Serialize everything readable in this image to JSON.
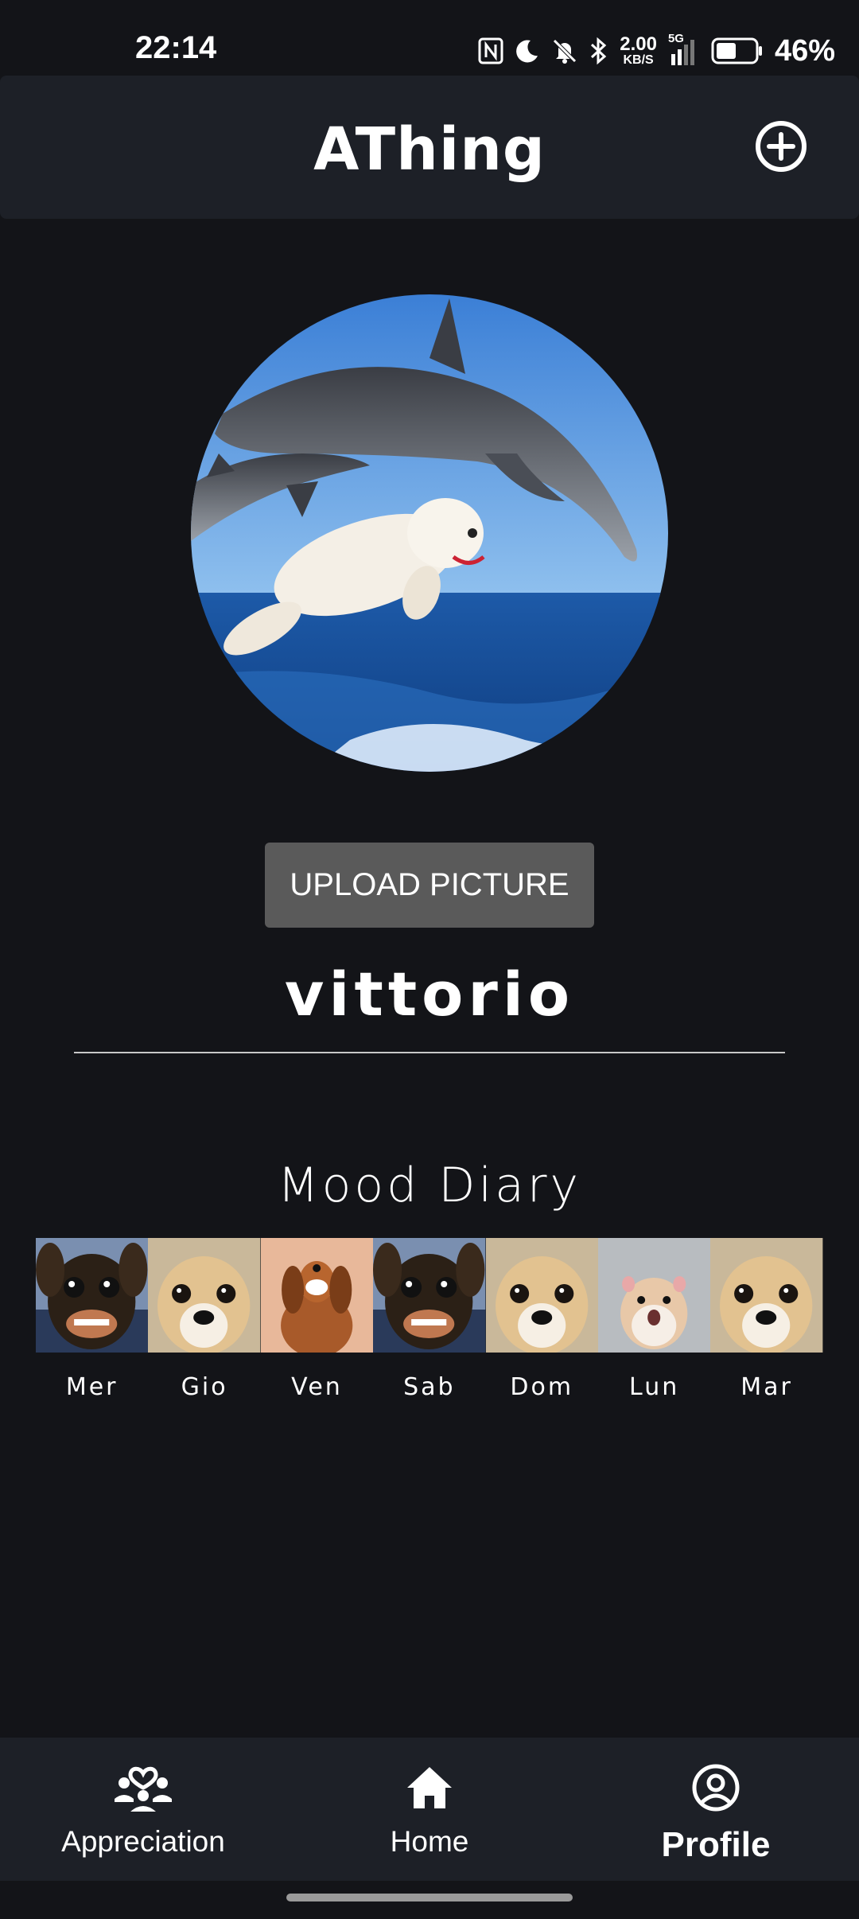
{
  "status_bar": {
    "time": "22:14",
    "net_speed_value": "2.00",
    "net_speed_unit": "KB/S",
    "network": "5G",
    "battery_percent": "46%",
    "icons": [
      "nfc-icon",
      "moon-icon",
      "bell-off-icon",
      "bluetooth-icon",
      "signal-icon",
      "battery-icon"
    ]
  },
  "app_bar": {
    "title": "AThing",
    "add_icon": "plus-circle-icon"
  },
  "profile": {
    "avatar_alt": "dolphin-dog-picture",
    "upload_label": "UPLOAD PICTURE",
    "username": "vittorio"
  },
  "mood_diary": {
    "title": "Mood Diary",
    "days": [
      {
        "label": "Mer",
        "image": "grinning-chihuahua"
      },
      {
        "label": "Gio",
        "image": "staring-chihuahua"
      },
      {
        "label": "Ven",
        "image": "laughing-dachshund"
      },
      {
        "label": "Sab",
        "image": "grinning-chihuahua"
      },
      {
        "label": "Dom",
        "image": "staring-chihuahua"
      },
      {
        "label": "Lun",
        "image": "surprised-hamster"
      },
      {
        "label": "Mar",
        "image": "staring-chihuahua"
      }
    ]
  },
  "bottom_nav": {
    "items": [
      {
        "label": "Appreciation",
        "icon": "people-heart-icon",
        "active": false
      },
      {
        "label": "Home",
        "icon": "home-icon",
        "active": false
      },
      {
        "label": "Profile",
        "icon": "account-circle-icon",
        "active": true
      }
    ]
  },
  "colors": {
    "background": "#131418",
    "surface": "#1d2027",
    "button": "#5a5a5a",
    "text": "#ffffff"
  }
}
